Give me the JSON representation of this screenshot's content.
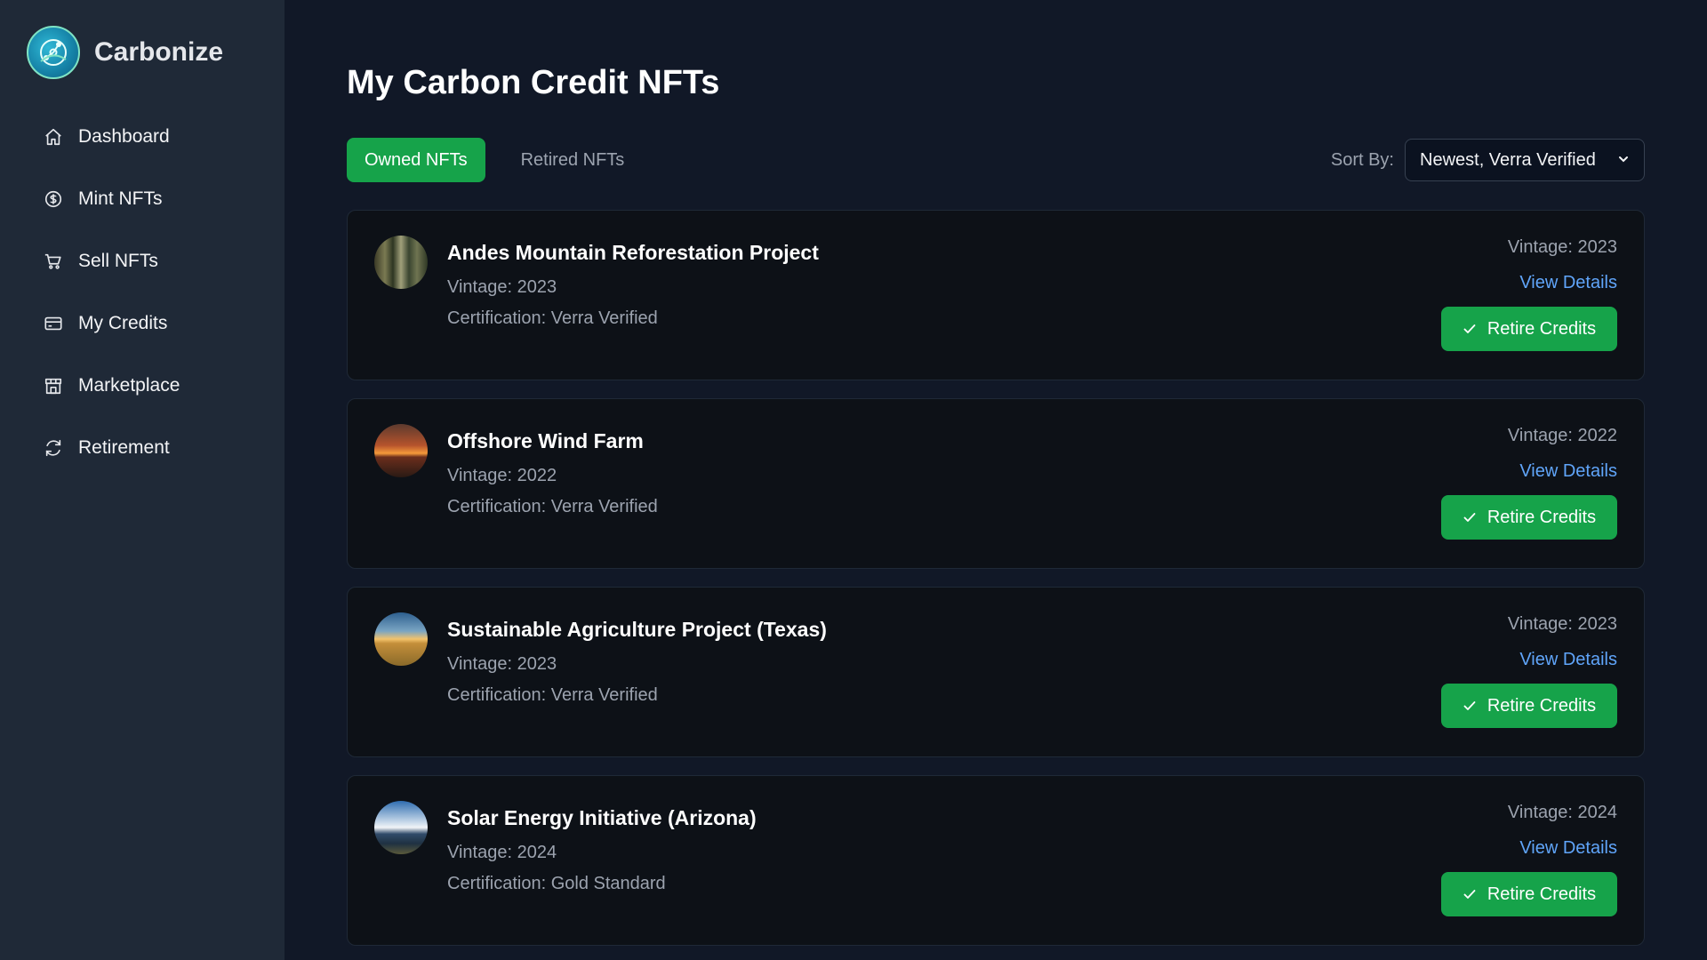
{
  "brand": {
    "name": "Carbonize"
  },
  "sidebar": {
    "items": [
      {
        "label": "Dashboard",
        "icon": "home-icon"
      },
      {
        "label": "Mint NFTs",
        "icon": "dollar-circle-icon"
      },
      {
        "label": "Sell NFTs",
        "icon": "cart-icon"
      },
      {
        "label": "My Credits",
        "icon": "credit-card-icon"
      },
      {
        "label": "Marketplace",
        "icon": "store-icon"
      },
      {
        "label": "Retirement",
        "icon": "refresh-icon"
      }
    ]
  },
  "main": {
    "title": "My Carbon Credit NFTs",
    "tabs": [
      {
        "label": "Owned NFTs",
        "active": true
      },
      {
        "label": "Retired NFTs",
        "active": false
      }
    ],
    "sort": {
      "label": "Sort By:",
      "selected": "Newest, Verra Verified"
    }
  },
  "cards": [
    {
      "title": "Andes Mountain Reforestation Project",
      "vintage": "Vintage: 2023",
      "certification": "Certification: Verra Verified",
      "vintage_right": "Vintage: 2023",
      "view_label": "View Details",
      "retire_label": "Retire Credits",
      "thumb": "forest-thumbnail"
    },
    {
      "title": "Offshore Wind Farm",
      "vintage": "Vintage: 2022",
      "certification": "Certification: Verra Verified",
      "vintage_right": "Vintage: 2022",
      "view_label": "View Details",
      "retire_label": "Retire Credits",
      "thumb": "sunset-thumbnail"
    },
    {
      "title": "Sustainable Agriculture Project (Texas)",
      "vintage": "Vintage: 2023",
      "certification": "Certification: Verra Verified",
      "vintage_right": "Vintage: 2023",
      "view_label": "View Details",
      "retire_label": "Retire Credits",
      "thumb": "field-thumbnail"
    },
    {
      "title": "Solar Energy Initiative (Arizona)",
      "vintage": "Vintage: 2024",
      "certification": "Certification: Gold Standard",
      "vintage_right": "Vintage: 2024",
      "view_label": "View Details",
      "retire_label": "Retire Credits",
      "thumb": "solar-thumbnail"
    }
  ],
  "colors": {
    "accent": "#16a34a",
    "link": "#60a5fa",
    "sidebar_bg": "#1f2937",
    "page_bg": "#111827",
    "card_bg": "#0d1117"
  }
}
